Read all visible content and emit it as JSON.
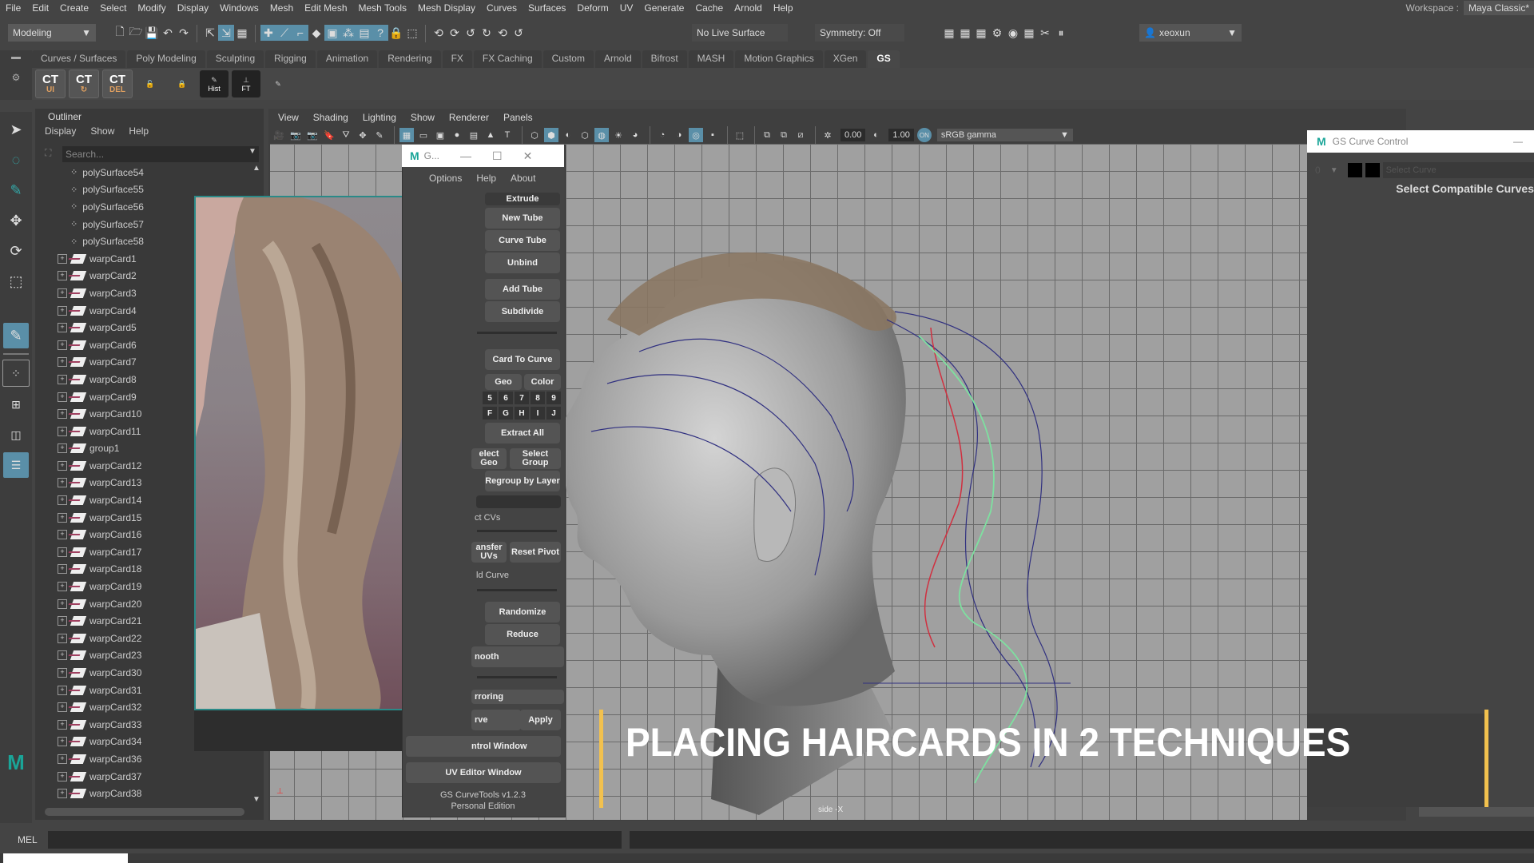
{
  "menubar": {
    "items": [
      "File",
      "Edit",
      "Create",
      "Select",
      "Modify",
      "Display",
      "Windows",
      "Mesh",
      "Edit Mesh",
      "Mesh Tools",
      "Mesh Display",
      "Curves",
      "Surfaces",
      "Deform",
      "UV",
      "Generate",
      "Cache",
      "Arnold",
      "Help"
    ],
    "workspace_label": "Workspace :",
    "workspace_value": "Maya Classic*"
  },
  "status_toolbar": {
    "menuset": "Modeling",
    "live_surface": "No Live Surface",
    "symmetry": "Symmetry: Off",
    "user": "xeoxun"
  },
  "shelf": {
    "tabs": [
      "Curves / Surfaces",
      "Poly Modeling",
      "Sculpting",
      "Rigging",
      "Animation",
      "Rendering",
      "FX",
      "FX Caching",
      "Custom",
      "Arnold",
      "Bifrost",
      "MASH",
      "Motion Graphics",
      "XGen",
      "GS"
    ],
    "active_tab": "GS",
    "buttons": [
      {
        "icon": "ct-ui-icon",
        "top": "CT",
        "sub": "UI"
      },
      {
        "icon": "ct-reload-icon",
        "top": "CT",
        "sub": "↻"
      },
      {
        "icon": "ct-del-icon",
        "top": "CT",
        "sub": "DEL"
      },
      {
        "icon": "unlock-icon",
        "top": "🔓",
        "sub": ""
      },
      {
        "icon": "lock-icon",
        "top": "🔒",
        "sub": ""
      },
      {
        "icon": "history-icon",
        "top": "✎",
        "sub": "Hist"
      },
      {
        "icon": "freeze-transform-icon",
        "top": "⊥",
        "sub": "FT"
      },
      {
        "icon": "curve-pencil-icon",
        "top": "✎",
        "sub": ""
      }
    ]
  },
  "outliner": {
    "tab": "Outliner",
    "menu": [
      "Display",
      "Show",
      "Help"
    ],
    "search_placeholder": "Search...",
    "mesh_items": [
      "polySurface54",
      "polySurface55",
      "polySurface56",
      "polySurface57",
      "polySurface58"
    ],
    "warp_items": [
      "warpCard1",
      "warpCard2",
      "warpCard3",
      "warpCard4",
      "warpCard5",
      "warpCard6",
      "warpCard7",
      "warpCard8",
      "warpCard9",
      "warpCard10",
      "warpCard11",
      "group1",
      "warpCard12",
      "warpCard13",
      "warpCard14",
      "warpCard15",
      "warpCard16",
      "warpCard17",
      "warpCard18",
      "warpCard19",
      "warpCard20",
      "warpCard21",
      "warpCard22",
      "warpCard23",
      "warpCard30",
      "warpCard31",
      "warpCard32",
      "warpCard33",
      "warpCard34",
      "warpCard36",
      "warpCard37",
      "warpCard38"
    ]
  },
  "viewport": {
    "menu": [
      "View",
      "Shading",
      "Lighting",
      "Show",
      "Renderer",
      "Panels"
    ],
    "exposure": "0.00",
    "gamma": "1.00",
    "color_space": "sRGB gamma",
    "camera_label": "side -X"
  },
  "gs_panel": {
    "title": "G...",
    "menu": [
      "Options",
      "Help",
      "About"
    ],
    "buttons": {
      "extrude": "Extrude",
      "new_tube": "New Tube",
      "curve_tube": "Curve Tube",
      "unbind": "Unbind",
      "add_tube": "Add Tube",
      "subdivide": "Subdivide",
      "card_to_curve": "Card To Curve",
      "geo": "Geo",
      "color": "Color",
      "layers_num": [
        "5",
        "6",
        "7",
        "8",
        "9"
      ],
      "layers_alpha": [
        "F",
        "G",
        "H",
        "I",
        "J"
      ],
      "extract_all": "Extract All",
      "select_geo": "elect Geo",
      "select_group": "Select Group",
      "regroup": "Regroup by Layer",
      "select_cvs": "ct CVs",
      "transfer_uvs": "ansfer UVs",
      "reset_pivot": "Reset Pivot",
      "build_curve": "ld Curve",
      "randomize": "Randomize",
      "reduce": "Reduce",
      "smooth": "nooth",
      "mirroring": "rroring",
      "curve": "rve",
      "apply": "Apply",
      "control_window": "ntrol Window",
      "uv_editor": "UV Editor Window"
    },
    "version": "GS CurveTools v1.2.3",
    "edition": "Personal Edition"
  },
  "curve_control": {
    "title": "GS Curve Control",
    "layer_value": "0",
    "select_curve_placeholder": "Select Curve",
    "compat_label": "Select Compatible Curves"
  },
  "caption": {
    "text": "PLACING HAIRCARDS IN 2 TECHNIQUES",
    "accent": "#f2c14e"
  },
  "cmdline": {
    "label": "MEL"
  },
  "colors": {
    "accent_blue": "#5a8fa8",
    "maya_teal": "#1aa598",
    "curve_red": "#d03040",
    "curve_green": "#7ee0a0",
    "curve_blue": "#303080"
  }
}
